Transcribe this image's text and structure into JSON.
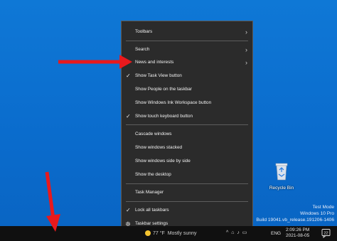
{
  "menu": {
    "items": [
      {
        "label": "Toolbars",
        "has_submenu": true
      },
      {
        "label": "Search",
        "has_submenu": true
      },
      {
        "label": "News and interests",
        "has_submenu": true
      },
      {
        "label": "Show Task View button",
        "checked": true
      },
      {
        "label": "Show People on the taskbar",
        "checked": false
      },
      {
        "label": "Show Windows Ink Workspace button",
        "checked": false
      },
      {
        "label": "Show touch keyboard button",
        "checked": true
      },
      {
        "label": "Cascade windows"
      },
      {
        "label": "Show windows stacked"
      },
      {
        "label": "Show windows side by side"
      },
      {
        "label": "Show the desktop"
      },
      {
        "label": "Task Manager"
      },
      {
        "label": "Lock all taskbars",
        "checked": true
      },
      {
        "label": "Taskbar settings",
        "icon": "gear-icon"
      }
    ]
  },
  "desktop": {
    "recycle_bin_label": "Recycle Bin",
    "watermark_line1": "Test Mode",
    "watermark_line2": "Windows 10 Pro",
    "watermark_line3": "Build 19041.vb_release.191206-1406"
  },
  "taskbar": {
    "weather_temp": "77 °F",
    "weather_desc": "Mostly sunny",
    "language": "ENG",
    "time": "2:09:26 PM",
    "date": "2021-08-05",
    "notification_count": "22"
  },
  "colors": {
    "desktop_bg": "#0a6fd0",
    "menu_bg": "#2b2b2b",
    "arrow": "#e8191d"
  }
}
